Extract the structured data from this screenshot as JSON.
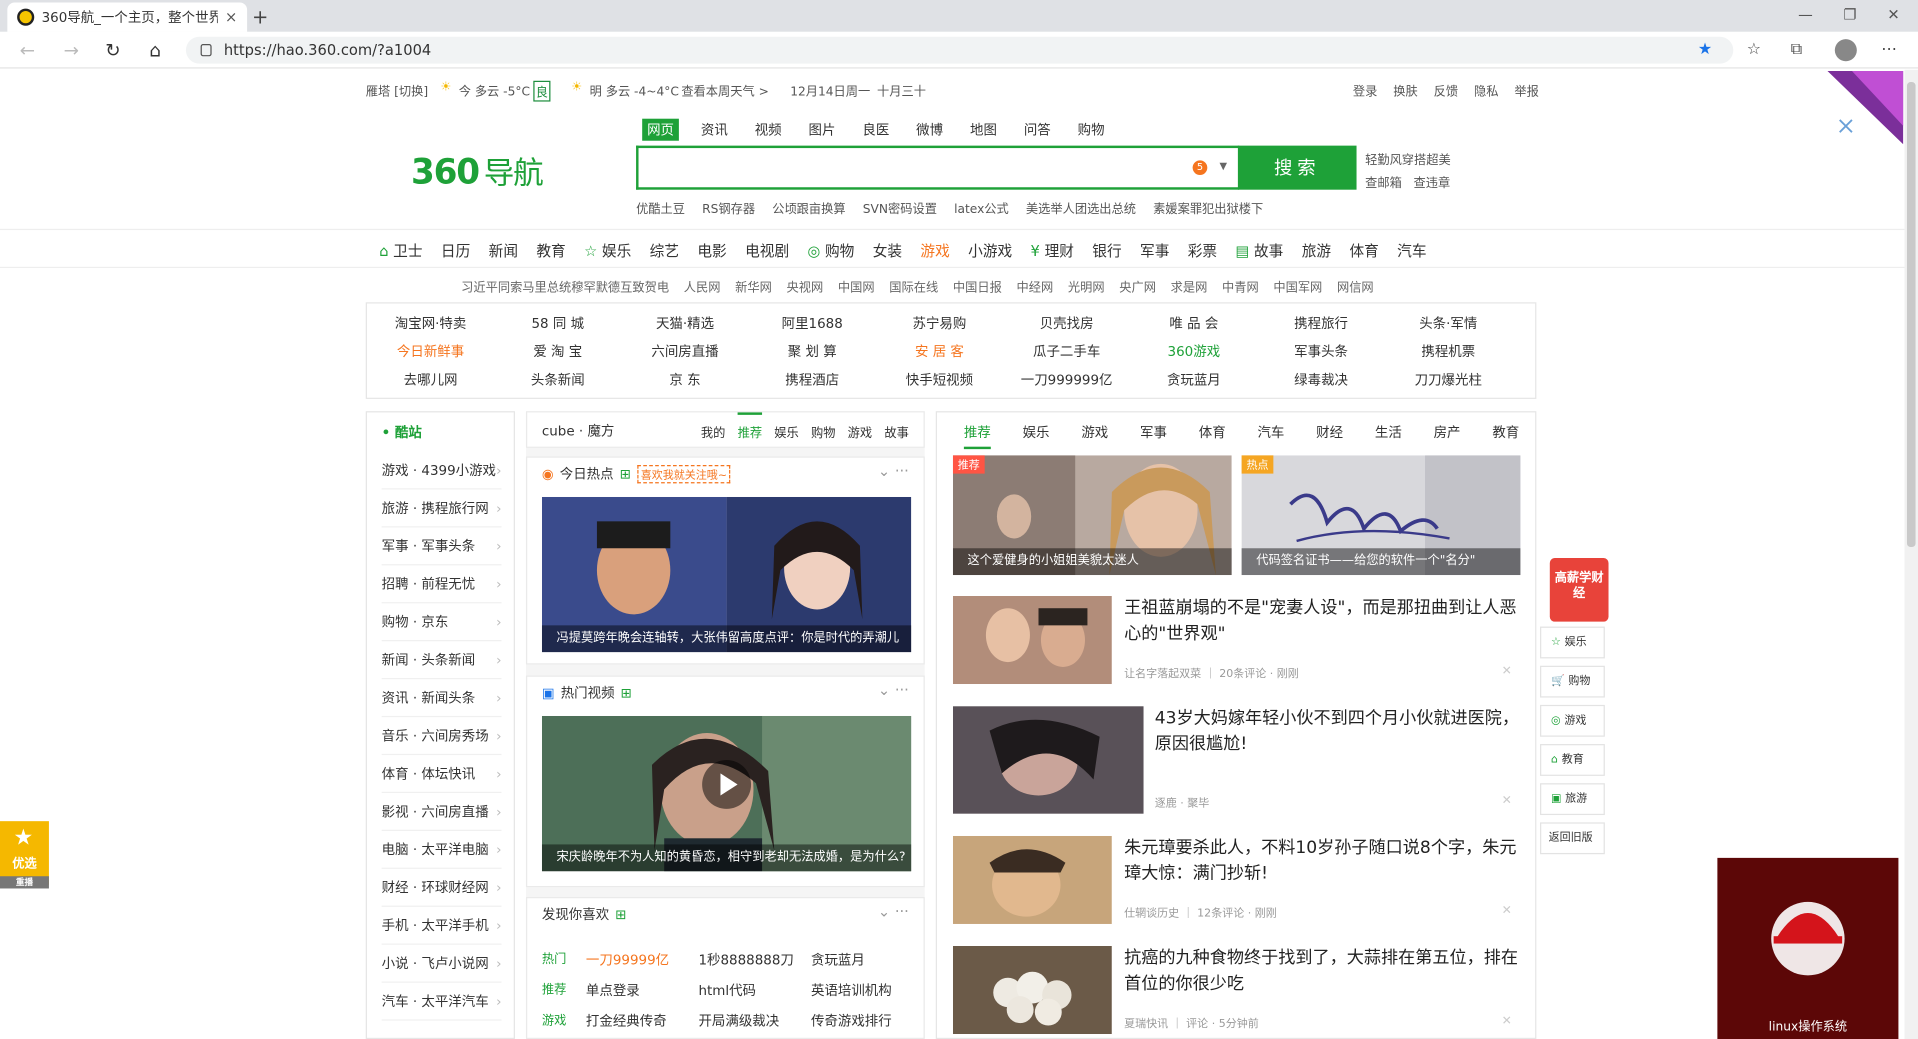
{
  "browser": {
    "tab_title": "360导航_一个主页，整个世界",
    "url": "https://hao.360.com/?a1004",
    "close": "×",
    "newtab": "+",
    "min": "—",
    "max": "❐",
    "winclose": "✕",
    "back": "←",
    "forward": "→",
    "refresh": "↻",
    "home": "⌂",
    "star": "★",
    "fav": "☆",
    "collections": "⧉",
    "more": "⋯"
  },
  "topinfo": {
    "city": "雁塔 [切换]",
    "today": "今 多云 -5°C",
    "aq": "良",
    "tomorrow": "明 多云 -4~4°C",
    "week": "查看本周天气 >",
    "date": "12月14日周一",
    "lunar": "十月三十"
  },
  "toplinks": [
    "登录",
    "换肤",
    "反馈",
    "隐私",
    "举报"
  ],
  "logo": {
    "num": "360",
    "text": "导航"
  },
  "search": {
    "tabs": [
      "网页",
      "资讯",
      "视频",
      "图片",
      "良医",
      "微博",
      "地图",
      "问答",
      "购物"
    ],
    "button": "搜索",
    "badge": "5",
    "hotlinks": [
      "优酷土豆",
      "RS钢存器",
      "公顷跟亩换算",
      "SVN密码设置",
      "latex公式",
      "美选举人团选出总统",
      "素媛案罪犯出狱楼下"
    ],
    "side1": "轻勤风穿搭超美",
    "side2": "查邮箱",
    "side3": "查违章"
  },
  "nav": [
    {
      "label": "卫士",
      "icon": "⌂"
    },
    {
      "label": "日历"
    },
    {
      "label": "新闻"
    },
    {
      "label": "教育"
    },
    {
      "label": "娱乐",
      "icon": "☆"
    },
    {
      "label": "综艺"
    },
    {
      "label": "电影"
    },
    {
      "label": "电视剧"
    },
    {
      "label": "购物",
      "icon": "◎"
    },
    {
      "label": "女装"
    },
    {
      "label": "游戏",
      "hl": true
    },
    {
      "label": "小游戏"
    },
    {
      "label": "理财",
      "icon": "¥"
    },
    {
      "label": "银行"
    },
    {
      "label": "军事"
    },
    {
      "label": "彩票"
    },
    {
      "label": "故事",
      "icon": "▤"
    },
    {
      "label": "旅游"
    },
    {
      "label": "体育"
    },
    {
      "label": "汽车"
    }
  ],
  "newsline": [
    "习近平同索马里总统穆罕默德互致贺电",
    "人民网",
    "新华网",
    "央视网",
    "中国网",
    "国际在线",
    "中国日报",
    "中经网",
    "光明网",
    "央广网",
    "求是网",
    "中青网",
    "中国军网",
    "网信网"
  ],
  "sites": [
    [
      "淘宝网·特卖",
      "58 同 城",
      "天猫·精选",
      "阿里1688",
      "苏宁易购",
      "贝壳找房",
      "唯 品 会",
      "携程旅行",
      "头条·军情"
    ],
    [
      "今日新鲜事",
      "爱 淘 宝",
      "六间房直播",
      "聚 划 算",
      "安 居 客",
      "瓜子二手车",
      "360游戏",
      "军事头条",
      "携程机票"
    ],
    [
      "去哪儿网",
      "头条新闻",
      "京 东",
      "携程酒店",
      "快手短视频",
      "一刀999999亿",
      "贪玩蓝月",
      "绿毒裁决",
      "刀刀爆光柱"
    ]
  ],
  "leftcol": {
    "head": "• 酷站",
    "items": [
      "游戏 · 4399小游戏",
      "旅游 · 携程旅行网",
      "军事 · 军事头条",
      "招聘 · 前程无忧",
      "购物 · 京东",
      "新闻 · 头条新闻",
      "资讯 · 新闻头条",
      "音乐 · 六间房秀场",
      "体育 · 体坛快讯",
      "影视 · 六间房直播",
      "电脑 · 太平洋电脑",
      "财经 · 环球财经网",
      "手机 · 太平洋手机",
      "小说 · 飞卢小说网",
      "汽车 · 太平洋汽车"
    ]
  },
  "cube": {
    "label": "cube · 魔方",
    "tabs": [
      "我的",
      "推荐",
      "娱乐",
      "购物",
      "游戏",
      "故事"
    ]
  },
  "hot": {
    "title": "今日热点",
    "badge": "喜欢我就关注哦~",
    "caption": "冯提莫跨年晚会连轴转，大张伟留高度点评：你是时代的弄潮儿"
  },
  "video": {
    "title": "热门视频",
    "caption": "宋庆龄晚年不为人知的黄昏恋，相守到老却无法成婚，是为什么?"
  },
  "like": {
    "title": "发现你喜欢",
    "rows": [
      [
        "热门",
        "一刀99999亿",
        "1秒8888888刀",
        "贪玩蓝月"
      ],
      [
        "推荐",
        "单点登录",
        "html代码",
        "英语培训机构"
      ],
      [
        "游戏",
        "打金经典传奇",
        "开局满级裁决",
        "传奇游戏排行"
      ]
    ]
  },
  "feedtabs": [
    "推荐",
    "娱乐",
    "游戏",
    "军事",
    "体育",
    "汽车",
    "财经",
    "生活",
    "房产",
    "教育"
  ],
  "tiles": [
    {
      "tag": "推荐",
      "caption": "这个爱健身的小姐姐美貌太迷人"
    },
    {
      "tag": "热点",
      "caption": "代码签名证书——给您的软件一个\"名分\""
    }
  ],
  "feed": [
    {
      "title": "王祖蓝崩塌的不是\"宠妻人设\"，而是那扭曲到让人恶心的\"世界观\"",
      "meta": "让名字落起双菜 ｜ 20条评论 · 刚刚"
    },
    {
      "title": "43岁大妈嫁年轻小伙不到四个月小伙就进医院，原因很尴尬!",
      "meta": "逐鹿 · 聚毕"
    },
    {
      "title": "朱元璋要杀此人，不料10岁孙子随口说8个字，朱元璋大惊：满门抄斩!",
      "meta": "仕辋谈历史 ｜ 12条评论 · 刚刚"
    },
    {
      "title": "抗癌的九种食物终于找到了，大蒜排在第五位，排在首位的你很少吃",
      "meta": "夏瑞快讯 ｜ 评论 · 5分钟前"
    }
  ],
  "rfloat": {
    "promo": "高薪学财经",
    "items": [
      "娱乐",
      "购物",
      "游戏",
      "教育",
      "旅游"
    ],
    "back": "返回旧版"
  },
  "redad": {
    "caption": "linux操作系统"
  },
  "youxuan": {
    "label": "优选",
    "sub": "重播"
  }
}
